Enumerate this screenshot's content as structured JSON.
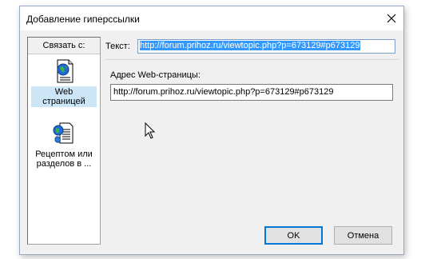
{
  "dialog": {
    "title": "Добавление гиперссылки",
    "close_icon": "close-icon"
  },
  "link_panel": {
    "header": "Связать с:",
    "items": [
      {
        "label_line1": "Web",
        "label_line2": "страницей",
        "icon": "web-page-icon",
        "selected": true
      },
      {
        "label_line1": "Рецептом или",
        "label_line2": "разделов в ...",
        "icon": "recipe-link-icon",
        "selected": false
      }
    ]
  },
  "text_field": {
    "label": "Текст:",
    "value": "http://forum.prihoz.ru/viewtopic.php?p=673129#p673129"
  },
  "url_field": {
    "label": "Адрес Web-страницы:",
    "value": "http://forum.prihoz.ru/viewtopic.php?p=673129#p673129"
  },
  "buttons": {
    "ok": "OK",
    "cancel": "Отмена"
  },
  "colors": {
    "selection": "#3399ff",
    "focus_border": "#0078d7",
    "dialog_bg": "#f0f0f0"
  }
}
